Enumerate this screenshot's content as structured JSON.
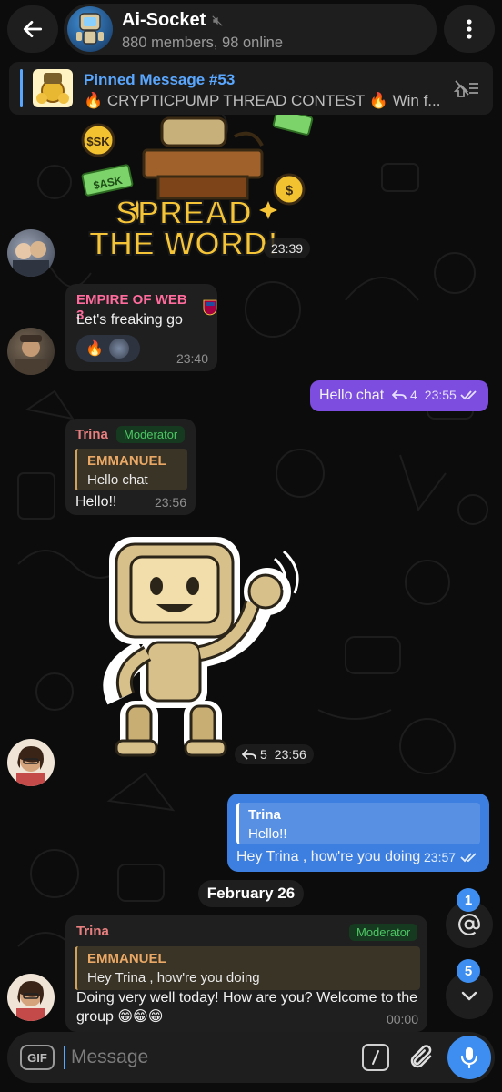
{
  "header": {
    "title": "Ai-Socket",
    "subtitle": "880 members, 98 online",
    "muted": true
  },
  "pinned": {
    "title": "Pinned Message #53",
    "text": "🔥 CRYPTICPUMP THREAD CONTEST 🔥  Win f..."
  },
  "messages": {
    "m1": {
      "sticker_text_1": "SPREAD",
      "sticker_text_2": "THE WORD!",
      "sticker_labels": [
        "$SK",
        "$ASK",
        "$"
      ],
      "time": "23:39"
    },
    "m2": {
      "sender": "EMPIRE OF WEB 3",
      "sender_color": "#ff6b9c",
      "text": "Let's freaking go",
      "reaction": "🔥",
      "time": "23:40"
    },
    "m3": {
      "text": "Hello chat",
      "reply_count": "4",
      "time": "23:55",
      "bubble_color": "#7c4dde"
    },
    "m4": {
      "sender": "Trina",
      "badge": "Moderator",
      "reply_name": "EMMANUEL",
      "reply_text": "Hello chat",
      "text": "Hello!!",
      "time": "23:56"
    },
    "m5": {
      "reply_count": "5",
      "time": "23:56"
    },
    "m6": {
      "reply_name": "Trina",
      "reply_text": "Hello!!",
      "text": "Hey Trina , how're you doing",
      "time": "23:57",
      "bubble_color": "#3d7fe0"
    },
    "date_divider": "February 26",
    "m7": {
      "sender": "Trina",
      "badge": "Moderator",
      "reply_name": "EMMANUEL",
      "reply_text": "Hey Trina , how're you doing",
      "text_line1": "Doing very well today!  How are you? Welcome to the",
      "text_line2": "group 😁😁😁",
      "time": "00:00"
    }
  },
  "mentions_badge": "1",
  "unread_badge": "5",
  "input": {
    "gif_label": "GIF",
    "placeholder": "Message"
  },
  "colors": {
    "accent": "#5aa7ff",
    "moderator": "#4cc764",
    "reply_name": "#e9a865"
  }
}
